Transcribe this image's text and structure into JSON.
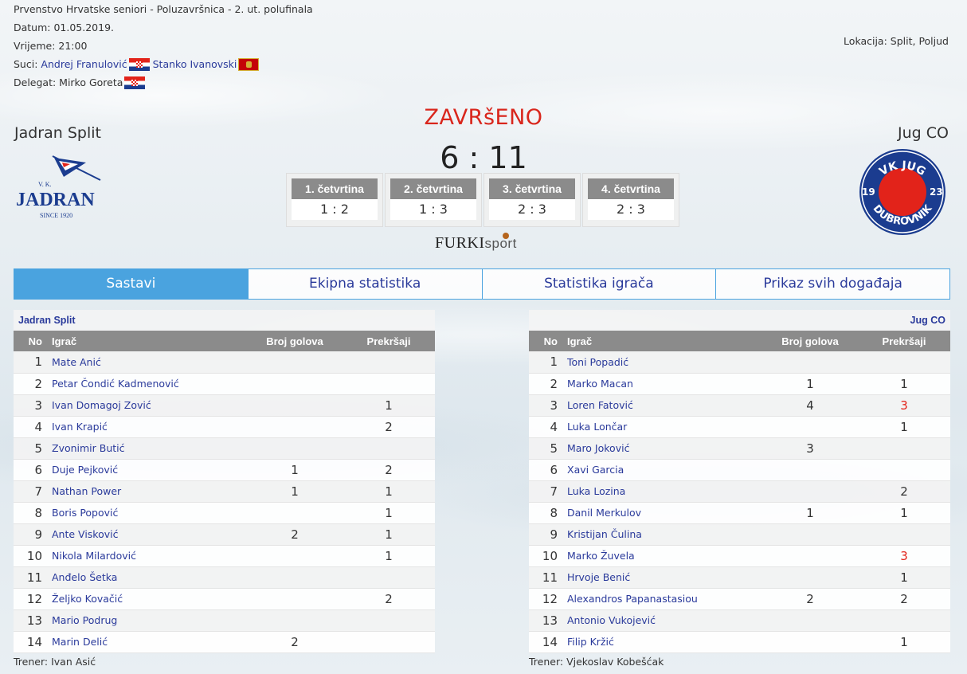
{
  "meta": {
    "competition": "Prvenstvo Hrvatske seniori - Poluzavršnica - 2. ut. polufinala",
    "date": "Datum: 01.05.2019.",
    "time": "Vrijeme: 21:00",
    "referees_label": "Suci:",
    "referee1": "Andrej Franulović",
    "referee2": "Stanko Ivanovski",
    "delegate_label": "Delegat: Mirko Goreta",
    "location": "Lokacija: Split, Poljud"
  },
  "match": {
    "status": "ZAVRšENO",
    "score": "6 : 11",
    "home": "Jadran Split",
    "away": "Jug CO",
    "quarters": [
      {
        "label": "1. četvrtina",
        "score": "1 : 2"
      },
      {
        "label": "2. četvrtina",
        "score": "1 : 3"
      },
      {
        "label": "3. četvrtina",
        "score": "2 : 3"
      },
      {
        "label": "4. četvrtina",
        "score": "2 : 3"
      }
    ]
  },
  "logos": {
    "home_text": "JADRAN",
    "home_vk": "V. K.",
    "home_since": "SINCE 1920",
    "away_top": "VK JUG",
    "away_bottom": "DUBROVNIK",
    "away_left": "19",
    "away_right": "23"
  },
  "sponsor": {
    "main": "FURKI",
    "sub": "sport"
  },
  "tabs": [
    "Sastavi",
    "Ekipna statistika",
    "Statistika igrača",
    "Prikaz svih događaja"
  ],
  "columns": {
    "no": "No",
    "player": "Igrač",
    "goals": "Broj golova",
    "fouls": "Prekršaji"
  },
  "colors": {
    "accent": "#4aa3df",
    "status": "#d9261c",
    "link": "#2a3a9b",
    "header_gray": "#8b8b8b"
  },
  "home_roster": {
    "team": "Jadran Split",
    "coach": "Trener: Ivan Asić",
    "players": [
      {
        "no": "1",
        "name": "Mate Anić",
        "goals": "",
        "fouls": ""
      },
      {
        "no": "2",
        "name": "Petar Čondić Kadmenović",
        "goals": "",
        "fouls": ""
      },
      {
        "no": "3",
        "name": "Ivan Domagoj Zović",
        "goals": "",
        "fouls": "1"
      },
      {
        "no": "4",
        "name": "Ivan Krapić",
        "goals": "",
        "fouls": "2"
      },
      {
        "no": "5",
        "name": "Zvonimir Butić",
        "goals": "",
        "fouls": ""
      },
      {
        "no": "6",
        "name": "Duje Pejković",
        "goals": "1",
        "fouls": "2"
      },
      {
        "no": "7",
        "name": "Nathan Power",
        "goals": "1",
        "fouls": "1"
      },
      {
        "no": "8",
        "name": "Boris Popović",
        "goals": "",
        "fouls": "1"
      },
      {
        "no": "9",
        "name": "Ante Visković",
        "goals": "2",
        "fouls": "1"
      },
      {
        "no": "10",
        "name": "Nikola Milardović",
        "goals": "",
        "fouls": "1"
      },
      {
        "no": "11",
        "name": "Anđelo Šetka",
        "goals": "",
        "fouls": ""
      },
      {
        "no": "12",
        "name": "Željko Kovačić",
        "goals": "",
        "fouls": "2"
      },
      {
        "no": "13",
        "name": "Mario Podrug",
        "goals": "",
        "fouls": ""
      },
      {
        "no": "14",
        "name": "Marin Delić",
        "goals": "2",
        "fouls": ""
      }
    ]
  },
  "away_roster": {
    "team": "Jug CO",
    "coach": "Trener: Vjekoslav Kobešćak",
    "players": [
      {
        "no": "1",
        "name": "Toni Popadić",
        "goals": "",
        "fouls": ""
      },
      {
        "no": "2",
        "name": "Marko Macan",
        "goals": "1",
        "fouls": "1"
      },
      {
        "no": "3",
        "name": "Loren Fatović",
        "goals": "4",
        "fouls": "3"
      },
      {
        "no": "4",
        "name": "Luka Lončar",
        "goals": "",
        "fouls": "1"
      },
      {
        "no": "5",
        "name": "Maro Joković",
        "goals": "3",
        "fouls": ""
      },
      {
        "no": "6",
        "name": "Xavi Garcia",
        "goals": "",
        "fouls": ""
      },
      {
        "no": "7",
        "name": "Luka Lozina",
        "goals": "",
        "fouls": "2"
      },
      {
        "no": "8",
        "name": "Danil Merkulov",
        "goals": "1",
        "fouls": "1"
      },
      {
        "no": "9",
        "name": "Kristijan Čulina",
        "goals": "",
        "fouls": ""
      },
      {
        "no": "10",
        "name": "Marko Žuvela",
        "goals": "",
        "fouls": "3"
      },
      {
        "no": "11",
        "name": "Hrvoje Benić",
        "goals": "",
        "fouls": "1"
      },
      {
        "no": "12",
        "name": "Alexandros Papanastasiou",
        "goals": "2",
        "fouls": "2"
      },
      {
        "no": "13",
        "name": "Antonio Vukojević",
        "goals": "",
        "fouls": ""
      },
      {
        "no": "14",
        "name": "Filip Kržić",
        "goals": "",
        "fouls": "1"
      }
    ]
  }
}
